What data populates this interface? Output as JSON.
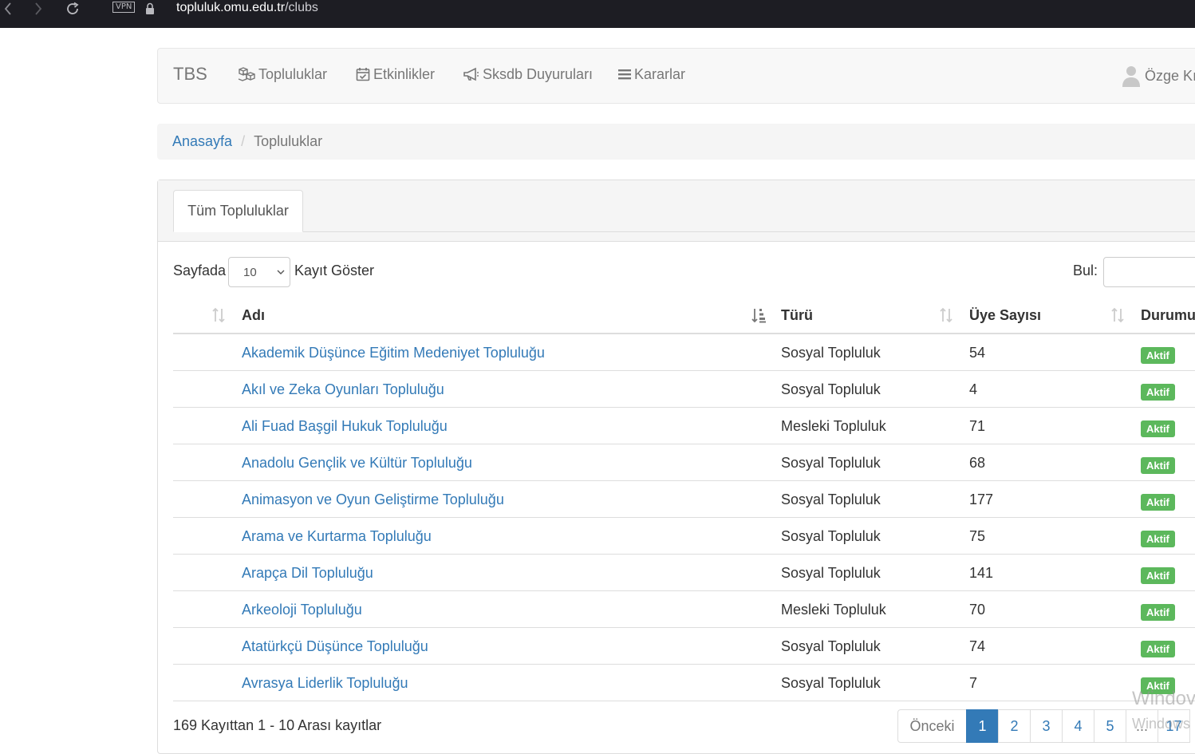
{
  "browser": {
    "url_domain": "topluluk.omu.edu.tr",
    "url_path": "/clubs",
    "vpn_label": "VPN"
  },
  "navbar": {
    "brand": "TBS",
    "items": [
      {
        "label": "Topluluklar",
        "icon": "cubes-icon"
      },
      {
        "label": "Etkinlikler",
        "icon": "calendar-check-icon"
      },
      {
        "label": "Sksdb Duyuruları",
        "icon": "bullhorn-icon"
      },
      {
        "label": "Kararlar",
        "icon": "bars-icon"
      }
    ],
    "user_name": "Özge Kı"
  },
  "breadcrumb": {
    "home": "Anasayfa",
    "current": "Topluluklar"
  },
  "tabs": {
    "active": "Tüm Topluluklar"
  },
  "table_controls": {
    "length_prefix": "Sayfada",
    "length_value": "10",
    "length_suffix": "Kayıt Göster",
    "search_label": "Bul:"
  },
  "table": {
    "headers": [
      "",
      "Adı",
      "Türü",
      "Üye Sayısı",
      "Durumu"
    ],
    "rows": [
      {
        "name": "Akademik Düşünce Eğitim Medeniyet Topluluğu",
        "type": "Sosyal Topluluk",
        "members": "54",
        "status": "Aktif"
      },
      {
        "name": "Akıl ve Zeka Oyunları Topluluğu",
        "type": "Sosyal Topluluk",
        "members": "4",
        "status": "Aktif"
      },
      {
        "name": "Ali Fuad Başgil Hukuk Topluluğu",
        "type": "Mesleki Topluluk",
        "members": "71",
        "status": "Aktif"
      },
      {
        "name": "Anadolu Gençlik ve Kültür Topluluğu",
        "type": "Sosyal Topluluk",
        "members": "68",
        "status": "Aktif"
      },
      {
        "name": "Animasyon ve Oyun Geliştirme Topluluğu",
        "type": "Sosyal Topluluk",
        "members": "177",
        "status": "Aktif"
      },
      {
        "name": "Arama ve Kurtarma Topluluğu",
        "type": "Sosyal Topluluk",
        "members": "75",
        "status": "Aktif"
      },
      {
        "name": "Arapça Dil Topluluğu",
        "type": "Sosyal Topluluk",
        "members": "141",
        "status": "Aktif"
      },
      {
        "name": "Arkeoloji Topluluğu",
        "type": "Mesleki Topluluk",
        "members": "70",
        "status": "Aktif"
      },
      {
        "name": "Atatürkçü Düşünce Topluluğu",
        "type": "Sosyal Topluluk",
        "members": "74",
        "status": "Aktif"
      },
      {
        "name": "Avrasya Liderlik Topluluğu",
        "type": "Sosyal Topluluk",
        "members": "7",
        "status": "Aktif"
      }
    ]
  },
  "footer": {
    "info": "169 Kayıttan 1 - 10 Arası kayıtlar"
  },
  "pagination": {
    "prev": "Önceki",
    "pages": [
      "1",
      "2",
      "3",
      "4",
      "5",
      "...",
      "17"
    ],
    "active_page": "1"
  },
  "watermark": {
    "line1": "Windov",
    "line2": "Windows"
  },
  "colors": {
    "link": "#337ab7",
    "badge_success": "#5cb85c",
    "browser_bar": "#1d1d23"
  }
}
